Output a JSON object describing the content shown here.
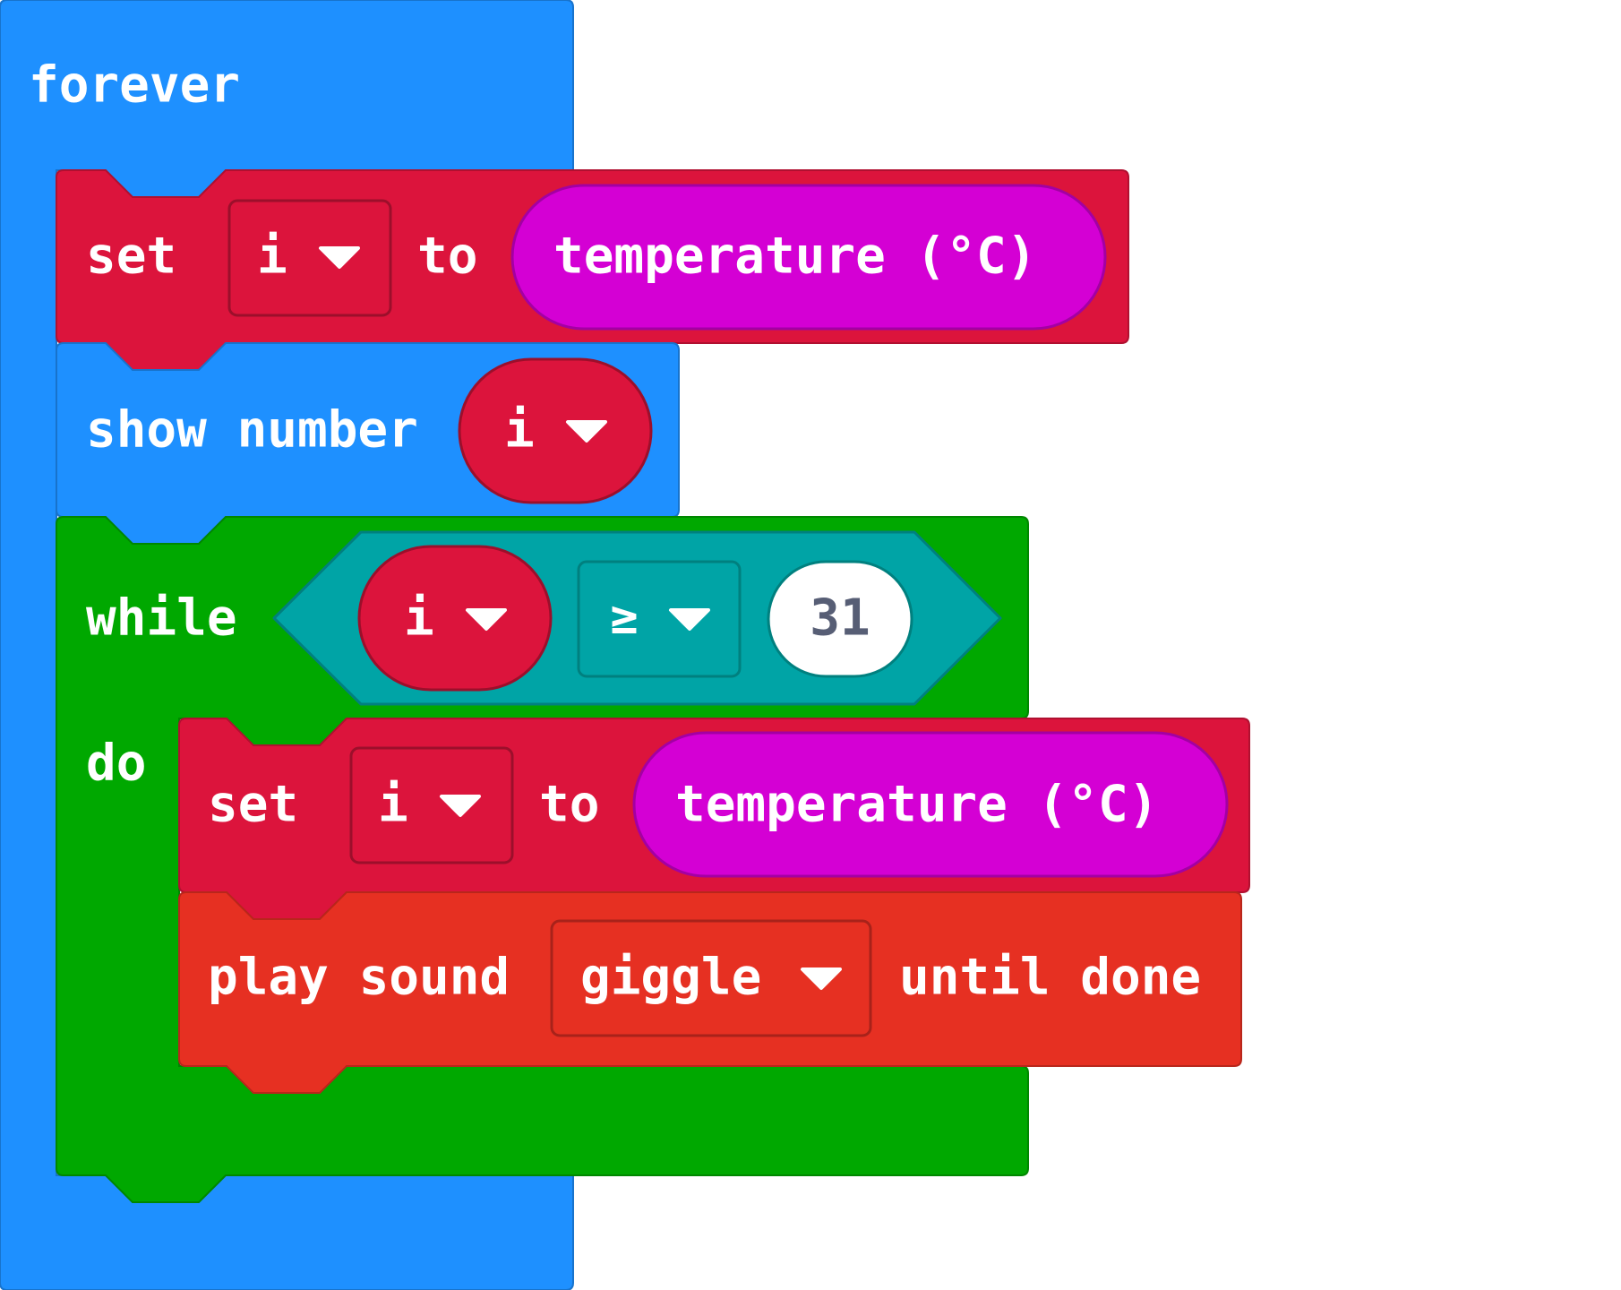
{
  "colors": {
    "loops": "#1e90ff",
    "variables": "#dc143c",
    "input": "#d400d4",
    "while_loop": "#00a800",
    "compare": "#00a4a6",
    "music": "#e63022",
    "number_text": "#575e75"
  },
  "icons": {
    "dropdown": "caret-down-icon"
  },
  "forever_block": {
    "label": "forever"
  },
  "set_block_1": {
    "set_label": "set",
    "variable": "i",
    "to_label": "to",
    "value": "temperature (°C)"
  },
  "show_number_block": {
    "label": "show number",
    "variable": "i"
  },
  "while_block": {
    "while_label": "while",
    "do_label": "do",
    "left_variable": "i",
    "operator": "≥",
    "right_value": "31"
  },
  "set_block_2": {
    "set_label": "set",
    "variable": "i",
    "to_label": "to",
    "value": "temperature (°C)"
  },
  "play_sound_block": {
    "play_label": "play sound",
    "sound": "giggle",
    "until_label": "until done"
  }
}
